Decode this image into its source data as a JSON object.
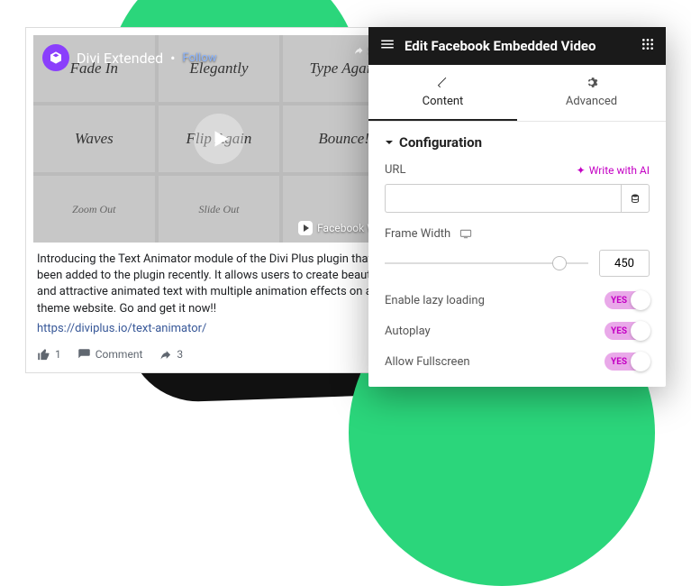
{
  "bg": {
    "blob_color": "#2bd67b"
  },
  "fb": {
    "page_name": "Divi Extended",
    "follow": "Follow",
    "share": "Share",
    "watch": "Facebook Watch",
    "grid": [
      "Fade In",
      "Elegantly",
      "Type Again",
      "Waves",
      "Flip Again",
      "Bounce!",
      "Zoom Out",
      "Slide Out",
      ""
    ],
    "desc": "Introducing the Text Animator module of the Divi Plus plugin that has been added to the plugin recently. It allows users to create beautiful and attractive animated text with multiple animation effects on a Divi theme website. Go and get it now!!",
    "link": "https://diviplus.io/text-animator/",
    "like_count": "1",
    "comment": "Comment",
    "share_count": "3"
  },
  "editor": {
    "title": "Edit Facebook Embedded Video",
    "tabs": {
      "content": "Content",
      "advanced": "Advanced"
    },
    "section": "Configuration",
    "url_label": "URL",
    "ai": "Write with AI",
    "url_value": "",
    "framewidth_label": "Frame Width",
    "framewidth_value": "450",
    "toggles": {
      "lazy": {
        "label": "Enable lazy loading",
        "state": "YES"
      },
      "autoplay": {
        "label": "Autoplay",
        "state": "YES"
      },
      "fullscreen": {
        "label": "Allow Fullscreen",
        "state": "YES"
      }
    }
  }
}
